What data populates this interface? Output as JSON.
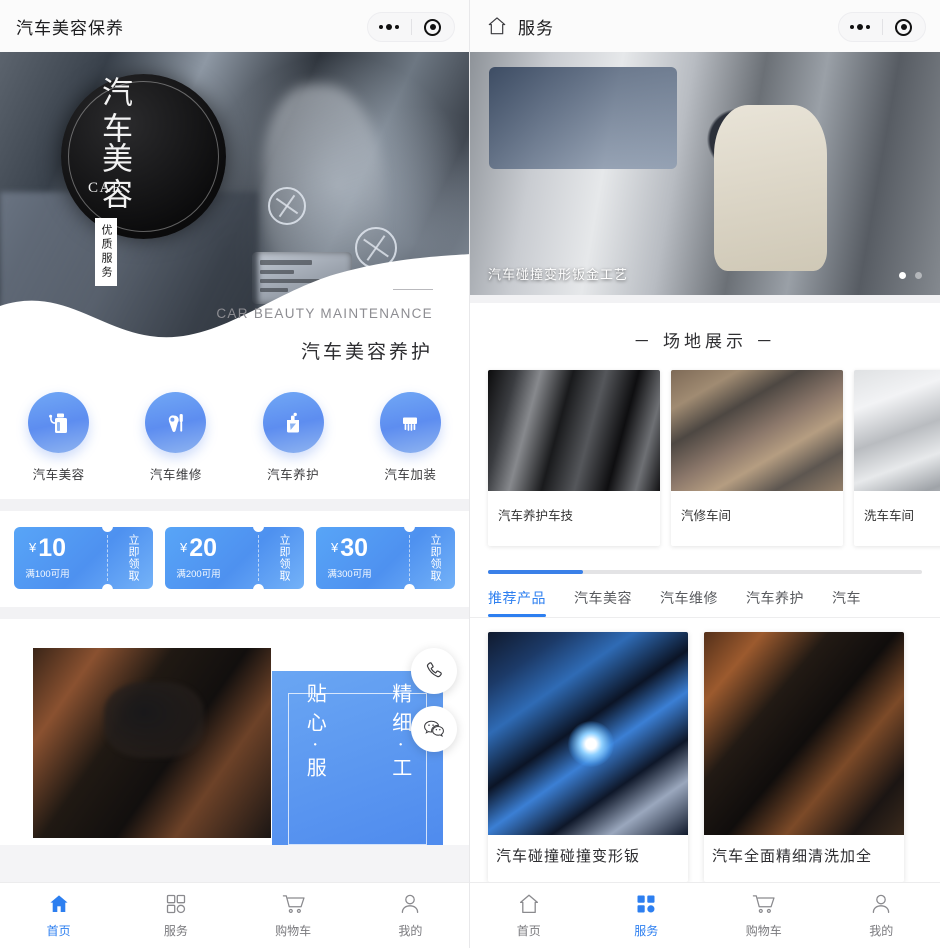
{
  "left": {
    "header": {
      "title": "汽车美容保养",
      "more_icon": "more-dots-icon",
      "target_icon": "target-icon"
    },
    "hero": {
      "badge_col1": "汽车",
      "badge_col2": "美容",
      "badge_en": "CAR",
      "badge_tag": "优质服务",
      "subtitle_en": "CAR BEAUTY MAINTENANCE",
      "subtitle_cn": "汽车美容养护"
    },
    "categories": [
      {
        "label": "汽车美容",
        "icon": "car-wash-bucket-icon"
      },
      {
        "label": "汽车维修",
        "icon": "wrench-screwdriver-icon"
      },
      {
        "label": "汽车养护",
        "icon": "oil-can-icon"
      },
      {
        "label": "汽车加装",
        "icon": "car-grille-icon"
      }
    ],
    "coupons": [
      {
        "currency": "¥",
        "amount": "10",
        "condition": "满100可用",
        "action": "立即领取"
      },
      {
        "currency": "¥",
        "amount": "20",
        "condition": "满200可用",
        "action": "立即领取"
      },
      {
        "currency": "¥",
        "amount": "30",
        "condition": "满300可用",
        "action": "立即领取"
      }
    ],
    "promo": {
      "col_right": "精细·工",
      "col_left": "贴心·服"
    },
    "fabs": [
      {
        "name": "phone-icon",
        "label": "电话"
      },
      {
        "name": "wechat-icon",
        "label": "微信"
      }
    ],
    "tabbar": [
      {
        "label": "首页",
        "icon": "home-icon",
        "active": true
      },
      {
        "label": "服务",
        "icon": "grid-icon",
        "active": false
      },
      {
        "label": "购物车",
        "icon": "cart-icon",
        "active": false
      },
      {
        "label": "我的",
        "icon": "user-icon",
        "active": false
      }
    ]
  },
  "right": {
    "header": {
      "home_icon": "home-outline-icon",
      "title": "服务",
      "more_icon": "more-dots-icon",
      "target_icon": "target-icon"
    },
    "banner": {
      "caption": "汽车碰撞变形钣金工艺",
      "dots": 2,
      "active_dot": 0
    },
    "section_title": "－ 场地展示 －",
    "venues": [
      {
        "name": "汽车养护车技"
      },
      {
        "name": "汽修车间"
      },
      {
        "name": "洗车车间"
      }
    ],
    "product_tabs": [
      {
        "label": "推荐产品",
        "active": true
      },
      {
        "label": "汽车美容",
        "active": false
      },
      {
        "label": "汽车维修",
        "active": false
      },
      {
        "label": "汽车养护",
        "active": false
      },
      {
        "label": "汽车",
        "active": false
      }
    ],
    "products": [
      {
        "name": "汽车碰撞碰撞变形钣"
      },
      {
        "name": "汽车全面精细清洗加全"
      }
    ],
    "tabbar": [
      {
        "label": "首页",
        "icon": "home-icon",
        "active": false
      },
      {
        "label": "服务",
        "icon": "grid-icon",
        "active": true
      },
      {
        "label": "购物车",
        "icon": "cart-icon",
        "active": false
      },
      {
        "label": "我的",
        "icon": "user-icon",
        "active": false
      }
    ]
  },
  "colors": {
    "accent": "#2d7ff0",
    "coupon": "#4e91f0",
    "tab_inactive": "#7a7a7e"
  }
}
